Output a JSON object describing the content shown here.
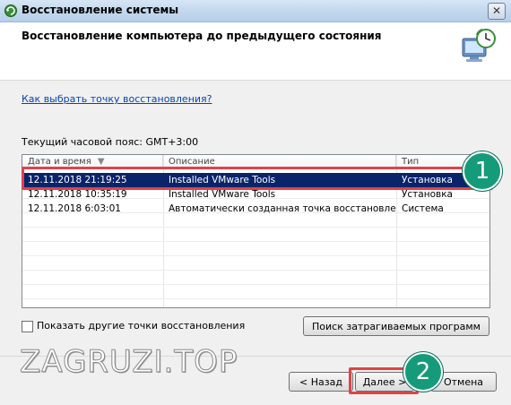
{
  "window": {
    "title": "Восстановление системы",
    "close_label": "✕"
  },
  "header": {
    "title": "Восстановление компьютера до предыдущего состояния"
  },
  "link": {
    "how_to_choose": "Как выбрать точку восстановления?"
  },
  "timezone": {
    "label": "Текущий часовой пояс: GMT+3:00"
  },
  "table": {
    "columns": [
      "Дата и время",
      "Описание",
      "Тип"
    ],
    "rows": [
      {
        "date": "12.11.2018 21:19:25",
        "description": "Installed VMware Tools",
        "type": "Установка"
      },
      {
        "date": "12.11.2018 10:35:19",
        "description": "Installed VMware Tools",
        "type": "Установка"
      },
      {
        "date": "12.11.2018 6:03:01",
        "description": "Автоматически созданная точка восстановле...",
        "type": "Система"
      }
    ],
    "selected_index": 0
  },
  "options": {
    "show_more_label": "Показать другие точки восстановления",
    "show_more_checked": false,
    "scan_button": "Поиск затрагиваемых программ"
  },
  "footer": {
    "back_button": "< Назад",
    "next_button": "Далее >",
    "cancel_button": "Отмена"
  },
  "annotations": {
    "badge_1": "1",
    "badge_2": "2",
    "watermark": "ZAGRUZI.TOP",
    "highlight_color": "#e0424a",
    "badge_color": "#169b7a"
  }
}
